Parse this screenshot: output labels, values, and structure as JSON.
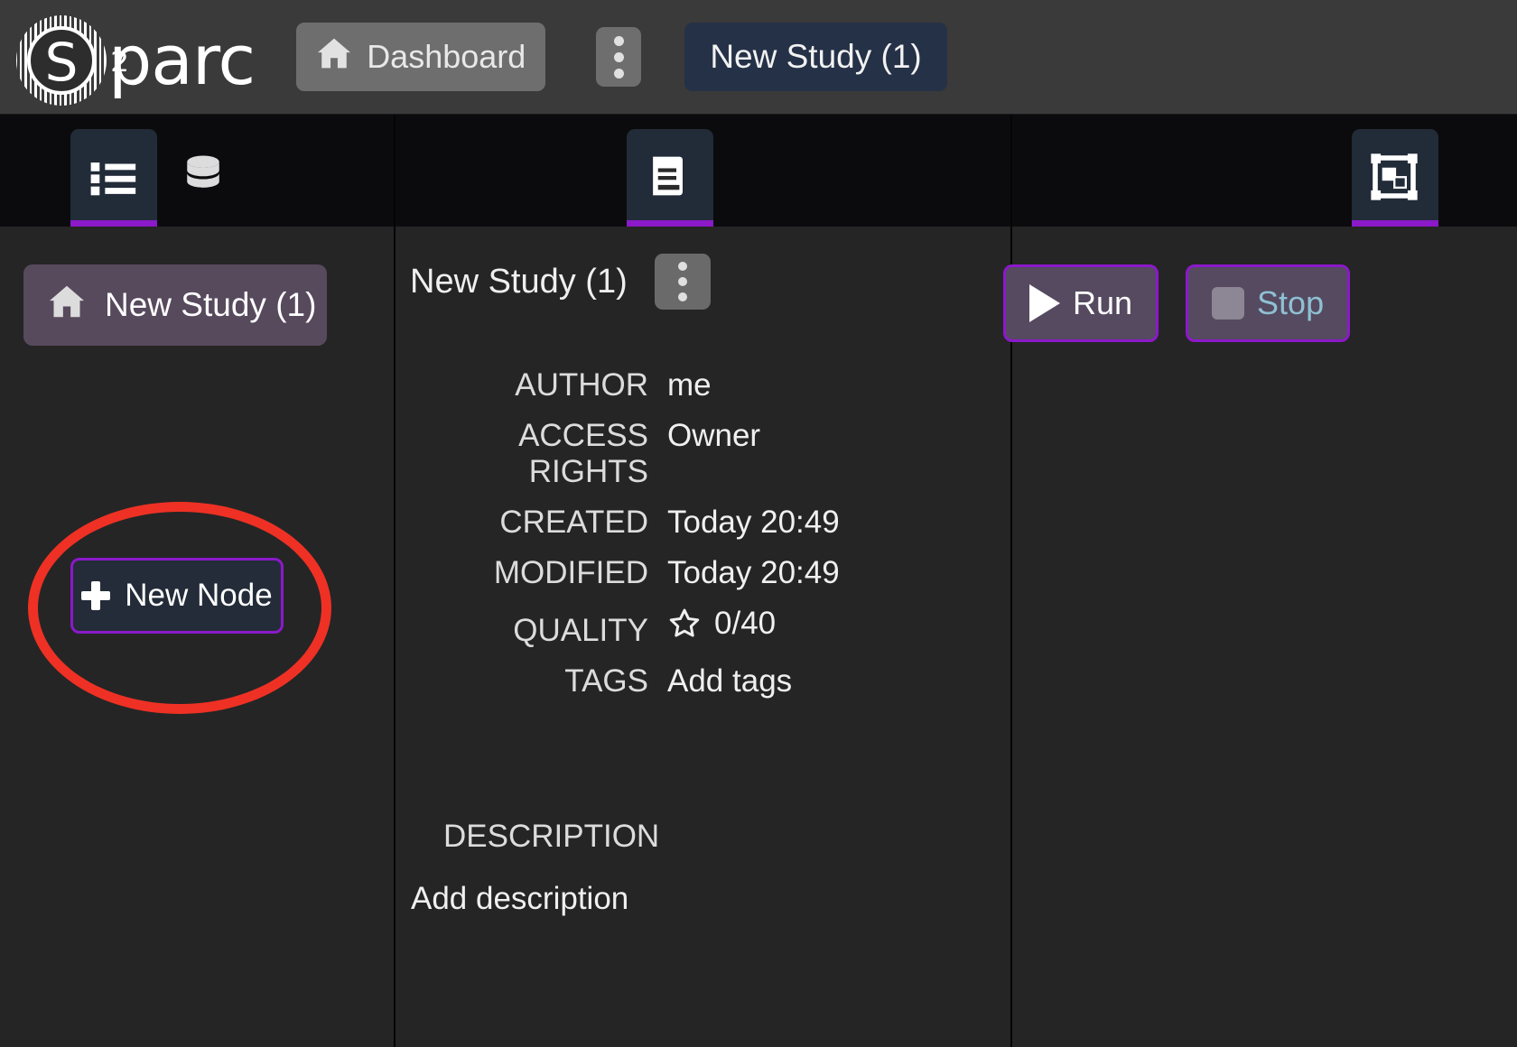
{
  "navbar": {
    "logo_text": "parc",
    "logo_superscript": "2",
    "logo_letter": "S",
    "dashboard_label": "Dashboard",
    "home_icon": "home-icon",
    "kebab_icon": "kebab-menu-icon",
    "study_tab_label": "New Study (1)"
  },
  "left_panel": {
    "tabs": [
      {
        "icon": "list-icon",
        "active": true
      },
      {
        "icon": "database-icon",
        "active": false
      }
    ],
    "breadcrumb_label": "New Study (1)",
    "breadcrumb_icon": "home-icon",
    "new_node_label": "New Node",
    "new_node_icon": "plus-icon",
    "annotation": "red-ellipse-highlight"
  },
  "middle_panel": {
    "tabs": [
      {
        "icon": "document-icon",
        "active": true
      }
    ],
    "title": "New Study (1)",
    "kebab_icon": "kebab-menu-icon",
    "metadata": [
      {
        "label": "AUTHOR",
        "value": "me"
      },
      {
        "label": "ACCESS RIGHTS",
        "value": "Owner"
      },
      {
        "label": "CREATED",
        "value": "Today 20:49"
      },
      {
        "label": "MODIFIED",
        "value": "Today 20:49"
      },
      {
        "label": "QUALITY",
        "value": "0/40",
        "icon": "star-outline-icon"
      },
      {
        "label": "TAGS",
        "value": "Add tags"
      }
    ],
    "description_label": "DESCRIPTION",
    "description_value": "Add description"
  },
  "right_panel": {
    "tabs": [
      {
        "icon": "node-group-icon",
        "active": true
      }
    ],
    "run_label": "Run",
    "run_icon": "play-icon",
    "stop_label": "Stop",
    "stop_icon": "stop-square-icon"
  },
  "colors": {
    "accent_purple": "#8b19c9",
    "annotation_red": "#ee3124",
    "navbar_bg": "#3a3a3a",
    "panel_bg": "#252525",
    "tabstrip_bg": "#0b0b0d",
    "active_tab_bg": "#222b38",
    "breadcrumb_bg": "#574a5d",
    "study_tab_bg": "#253147",
    "stop_text": "#8fc0d4"
  }
}
